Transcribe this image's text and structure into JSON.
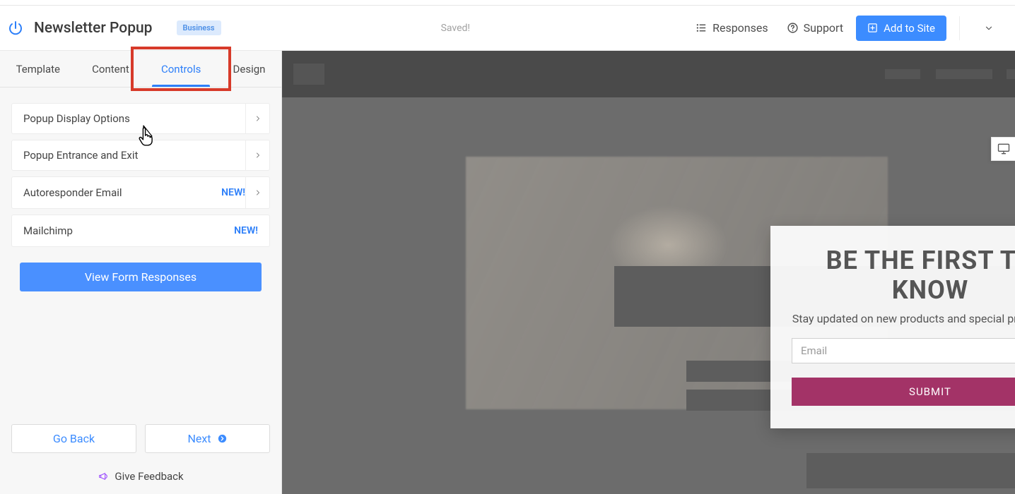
{
  "header": {
    "title": "Newsletter Popup",
    "plan_badge": "Business",
    "saved_status": "Saved!",
    "responses_link": "Responses",
    "support_link": "Support",
    "add_to_site_label": "Add to Site"
  },
  "tabs": [
    {
      "label": "Template"
    },
    {
      "label": "Content"
    },
    {
      "label": "Controls",
      "active": true,
      "highlighted": true
    },
    {
      "label": "Design"
    }
  ],
  "controls_panel": {
    "items": [
      {
        "label": "Popup Display Options",
        "has_chevron": true
      },
      {
        "label": "Popup Entrance and Exit",
        "has_chevron": true
      },
      {
        "label": "Autoresponder Email",
        "badge": "NEW!",
        "has_chevron": true
      },
      {
        "label": "Mailchimp",
        "badge": "NEW!",
        "has_chevron": false
      }
    ],
    "view_responses_label": "View Form Responses"
  },
  "footer": {
    "go_back_label": "Go Back",
    "next_label": "Next",
    "feedback_label": "Give Feedback"
  },
  "preview": {
    "modal": {
      "title": "BE THE FIRST TO KNOW",
      "subtitle": "Stay updated on new products and special promotions.",
      "email_placeholder": "Email",
      "submit_label": "SUBMIT"
    }
  }
}
